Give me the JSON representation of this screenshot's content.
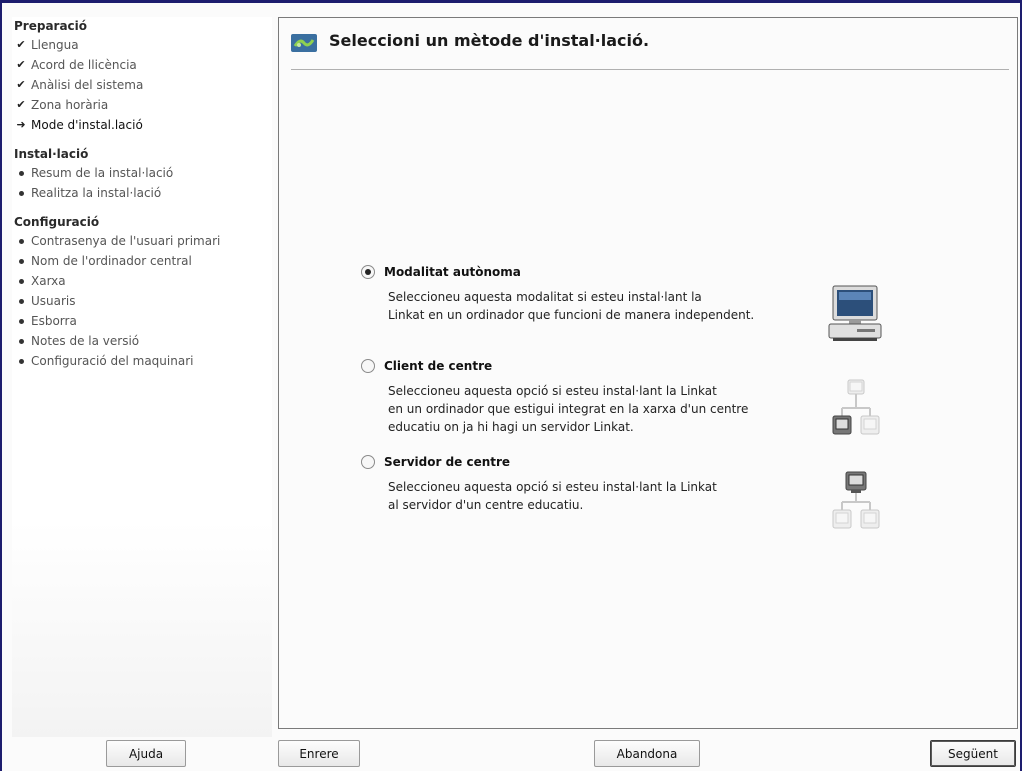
{
  "sidebar": {
    "groups": [
      {
        "title": "Preparació",
        "items": [
          {
            "label": "Llengua",
            "state": "done"
          },
          {
            "label": "Acord de llicència",
            "state": "done"
          },
          {
            "label": "Anàlisi del sistema",
            "state": "done"
          },
          {
            "label": "Zona horària",
            "state": "done"
          },
          {
            "label": "Mode d'instal.lació",
            "state": "current"
          }
        ]
      },
      {
        "title": "Instal·lació",
        "items": [
          {
            "label": "Resum de la instal·lació",
            "state": "pending"
          },
          {
            "label": "Realitza la instal·lació",
            "state": "pending"
          }
        ]
      },
      {
        "title": "Configuració",
        "items": [
          {
            "label": "Contrasenya de l'usuari primari",
            "state": "pending"
          },
          {
            "label": "Nom de l'ordinador central",
            "state": "pending"
          },
          {
            "label": "Xarxa",
            "state": "pending"
          },
          {
            "label": "Usuaris",
            "state": "pending"
          },
          {
            "label": "Esborra",
            "state": "pending"
          },
          {
            "label": "Notes de la versió",
            "state": "pending"
          },
          {
            "label": "Configuració del maquinari",
            "state": "pending"
          }
        ]
      }
    ]
  },
  "main": {
    "title": "Seleccioni un mètode d'instal·lació.",
    "options": [
      {
        "label": "Modalitat autònoma",
        "selected": true,
        "description": "Seleccioneu aquesta modalitat si esteu instal·lant la\nLinkat en un ordinador que funcioni de manera independent.",
        "icon": "desktop-computer-icon"
      },
      {
        "label": "Client de centre",
        "selected": false,
        "description": "Seleccioneu aquesta opció si esteu instal·lant la Linkat\nen un ordinador que estigui integrat en la xarxa d'un centre\neducatiu on ja hi hagi un servidor Linkat.",
        "icon": "network-client-icon"
      },
      {
        "label": "Servidor de centre",
        "selected": false,
        "description": "Seleccioneu aquesta opció si esteu instal·lant la Linkat\nal servidor d'un centre educatiu.",
        "icon": "network-server-icon"
      }
    ]
  },
  "buttons": {
    "help": "Ajuda",
    "back": "Enrere",
    "abort": "Abandona",
    "next": "Següent"
  },
  "colors": {
    "frame": "#1d1d6e",
    "panel_border": "#7a7a7a",
    "background": "#fbfbfb"
  }
}
